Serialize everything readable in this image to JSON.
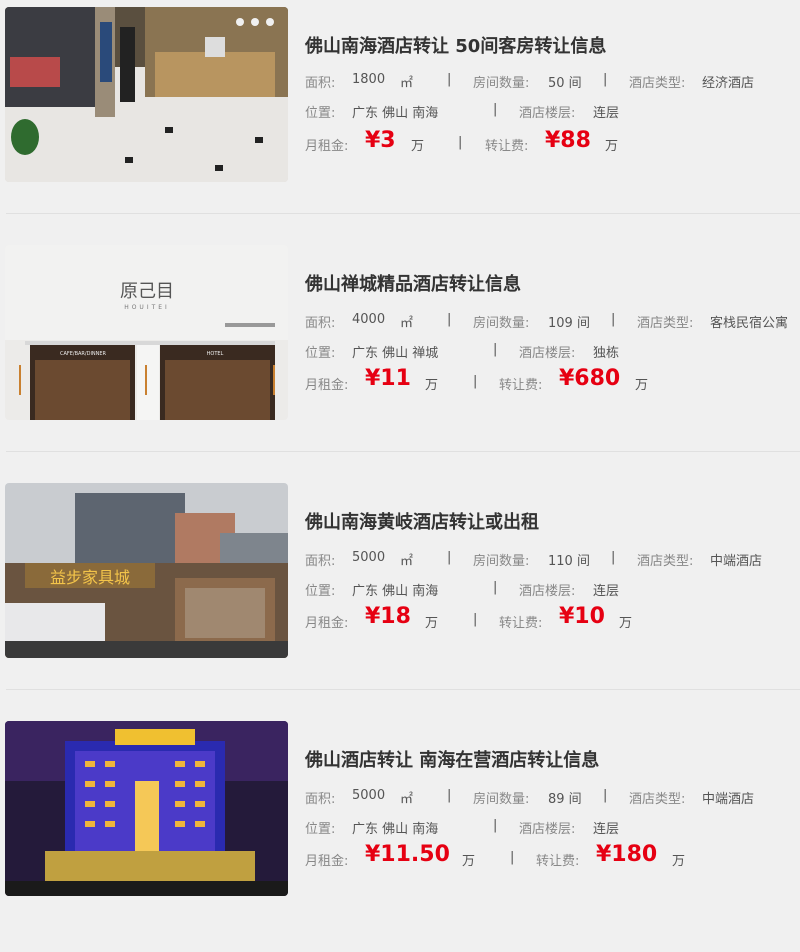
{
  "labels": {
    "area": "面积:",
    "rooms": "房间数量:",
    "hotel_type": "酒店类型:",
    "location": "位置:",
    "floor": "酒店楼层:",
    "rent": "月租金:",
    "transfer": "转让费:",
    "separator": "|",
    "area_unit": "㎡",
    "money_unit": "万"
  },
  "listings": [
    {
      "title": "佛山南海酒店转让 50间客房转让信息",
      "area": "1800",
      "rooms": "50 间",
      "hotel_type": "经济酒店",
      "location": "广东 佛山 南海",
      "floor": "连层",
      "rent": "¥3",
      "transfer": "¥88",
      "image": "hotel-lobby-photo"
    },
    {
      "title": "佛山禅城精品酒店转让信息",
      "area": "4000",
      "rooms": "109 间",
      "hotel_type": "客栈民宿公寓",
      "location": "广东 佛山 禅城",
      "floor": "独栋",
      "rent": "¥11",
      "transfer": "¥680",
      "image": "hotel-facade-photo",
      "sign_text": "原己目",
      "sign_sub": "HOUITEI",
      "cafe_sign": "CAFE/BAR/DINNER",
      "hotel_sign": "HOTEL"
    },
    {
      "title": "佛山南海黄岐酒店转让或出租",
      "area": "5000",
      "rooms": "110 间",
      "hotel_type": "中端酒店",
      "location": "广东 佛山 南海",
      "floor": "连层",
      "rent": "¥18",
      "transfer": "¥10",
      "image": "building-exterior-photo",
      "sign_text": "益步家具城"
    },
    {
      "title": "佛山酒店转让 南海在营酒店转让信息",
      "area": "5000",
      "rooms": "89 间",
      "hotel_type": "中端酒店",
      "location": "广东 佛山 南海",
      "floor": "连层",
      "rent": "¥11.50",
      "transfer": "¥180",
      "image": "night-hotel-photo"
    }
  ]
}
